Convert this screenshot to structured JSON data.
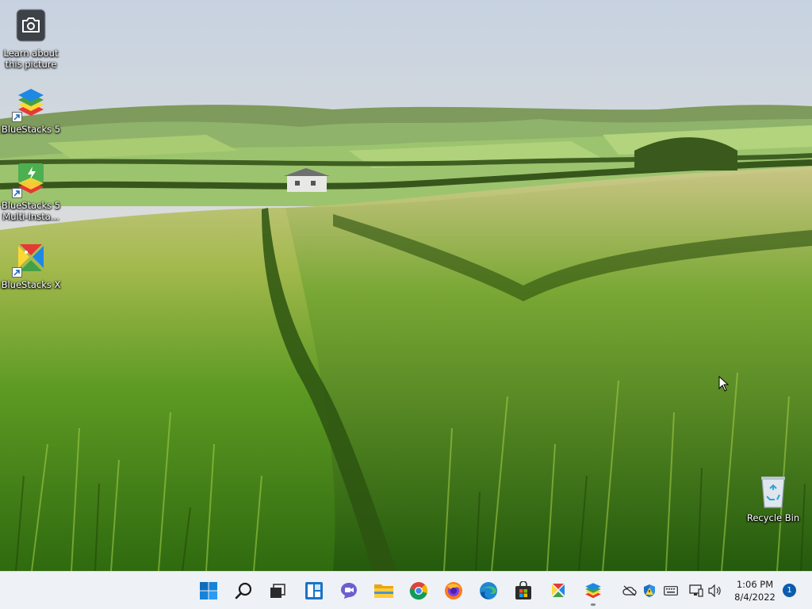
{
  "desktop": {
    "icons": [
      {
        "label": "Learn about\nthis picture",
        "icon": "camera-icon"
      },
      {
        "label": "BlueStacks 5",
        "icon": "bluestacks-5-icon"
      },
      {
        "label": "BlueStacks 5\nMulti-Insta...",
        "icon": "bluestacks-multi-instance-icon"
      },
      {
        "label": "BlueStacks X",
        "icon": "bluestacks-x-icon"
      },
      {
        "label": "Recycle Bin",
        "icon": "recycle-bin-icon"
      }
    ]
  },
  "taskbar": {
    "apps": [
      {
        "name": "Start",
        "icon": "windows-logo-icon"
      },
      {
        "name": "Search",
        "icon": "search-icon"
      },
      {
        "name": "Task View",
        "icon": "task-view-icon"
      },
      {
        "name": "Widgets",
        "icon": "widgets-icon"
      },
      {
        "name": "Chat",
        "icon": "teams-chat-icon"
      },
      {
        "name": "File Explorer",
        "icon": "folder-icon"
      },
      {
        "name": "Google Chrome",
        "icon": "chrome-icon"
      },
      {
        "name": "Firefox",
        "icon": "firefox-icon"
      },
      {
        "name": "Microsoft Edge",
        "icon": "edge-icon"
      },
      {
        "name": "Microsoft Store",
        "icon": "store-icon"
      },
      {
        "name": "BlueStacks X",
        "icon": "bluestacks-x-icon"
      },
      {
        "name": "BlueStacks 5",
        "icon": "bluestacks-5-icon"
      }
    ],
    "tray": [
      "onedrive-offline-icon",
      "security-shield-icon",
      "keyboard-icon",
      "network-icon",
      "volume-icon"
    ],
    "clock": {
      "time": "1:06 PM",
      "date": "8/4/2022"
    },
    "notification_count": "1"
  },
  "colors": {
    "taskbar_bg": "#eef1f6",
    "accent": "#0b5cad"
  }
}
